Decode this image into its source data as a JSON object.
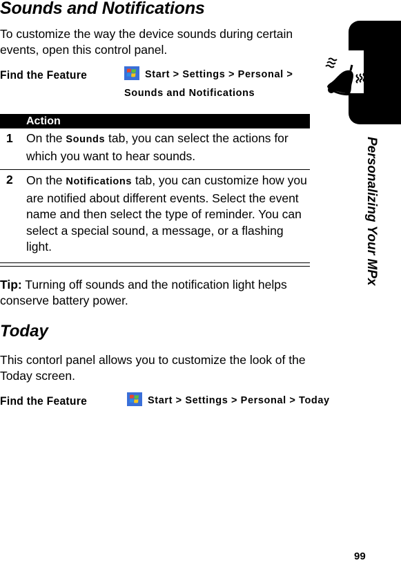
{
  "section": {
    "title": "Sounds and Notifications",
    "intro": "To customize the way the device sounds during certain events, open this control panel.",
    "find_feature": {
      "label": "Find the Feature",
      "icon": "windows-start-icon",
      "path_line1": "Start > Settings > Personal >",
      "path_line2": "Sounds and Notifications"
    },
    "table": {
      "header": "Action",
      "rows": [
        {
          "num": "1",
          "pre": "On the ",
          "keyword": "Sounds",
          "post": " tab, you can select the actions for which you want to hear sounds."
        },
        {
          "num": "2",
          "pre": "On the ",
          "keyword": "Notifications",
          "post": " tab, you can customize how you are notified about different events. Select the event name and then select the type of reminder. You can select a special sound, a message, or a flashing light."
        }
      ]
    },
    "tip_label": "Tip:",
    "tip_text": " Turning off sounds and the notification light helps conserve battery power."
  },
  "today": {
    "title": "Today",
    "text": "This contorl panel allows you to customize the look of the Today screen.",
    "find_feature": {
      "label": "Find the Feature",
      "icon": "windows-start-icon",
      "path": "Start > Settings > Personal > Today"
    }
  },
  "side_tab": {
    "icon": "ringing-bell-icon",
    "chapter_title": "Personalizing Your MPx"
  },
  "page_number": "99"
}
